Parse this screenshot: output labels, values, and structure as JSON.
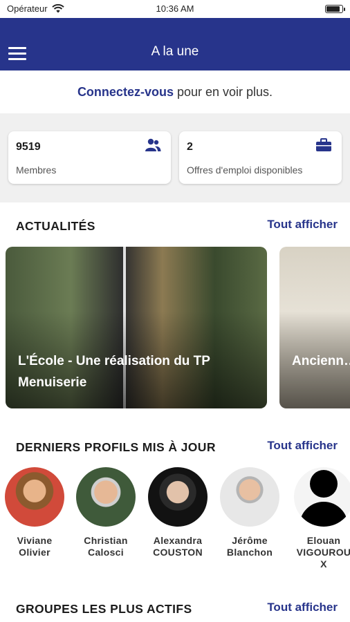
{
  "status_bar": {
    "carrier": "Opérateur",
    "time": "10:36 AM",
    "battery_level": 0.9
  },
  "header": {
    "title": "A la une"
  },
  "connect": {
    "link": "Connectez-vous",
    "text": "pour en voir plus."
  },
  "stats": [
    {
      "value": "9519",
      "label": "Membres",
      "icon": "members-icon"
    },
    {
      "value": "2",
      "label": "Offres d'emploi disponibles",
      "icon": "briefcase-icon"
    }
  ],
  "news": {
    "title": "ACTUALITÉS",
    "see_all": "Tout afficher",
    "items": [
      {
        "title": "L'École - Une réalisation du TP Menuiserie"
      },
      {
        "title": "Ancienn… à l'heure…"
      }
    ]
  },
  "profiles": {
    "title": "DERNIERS PROFILS MIS À JOUR",
    "see_all": "Tout afficher",
    "items": [
      {
        "first": "Viviane",
        "last": "Olivier"
      },
      {
        "first": "Christian",
        "last": "Calosci"
      },
      {
        "first": "Alexandra",
        "last": "COUSTON"
      },
      {
        "first": "Jérôme",
        "last": "Blanchon"
      },
      {
        "first": "Elouan",
        "last": "VIGOUROUX"
      }
    ]
  },
  "groups": {
    "title": "GROUPES LES PLUS ACTIFS",
    "see_all": "Tout afficher"
  },
  "colors": {
    "brand": "#27348b",
    "background_gray": "#f0f0f0"
  }
}
